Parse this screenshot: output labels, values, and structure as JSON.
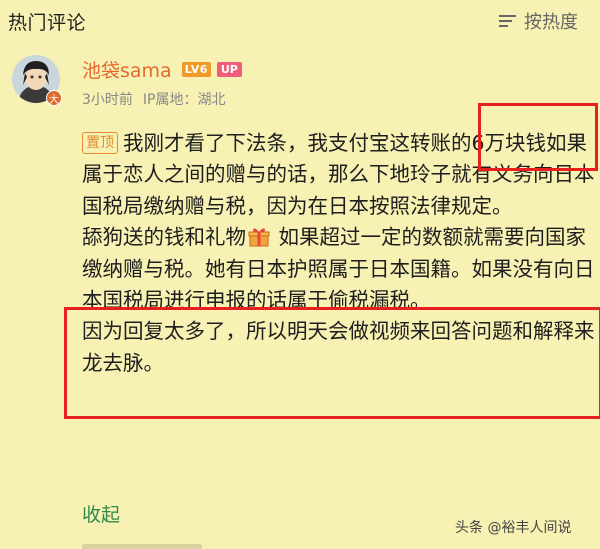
{
  "header": {
    "title": "热门评论",
    "sort_label": "按热度",
    "sort_icon": "sort-lines-icon"
  },
  "comment": {
    "user": {
      "name": "池袋sama",
      "level": "LV6",
      "badge": "UP",
      "avatar_badge": "大"
    },
    "meta": {
      "time": "3小时前",
      "location": "IP属地：湖北"
    },
    "pin_tag": "置顶",
    "paragraphs": {
      "p1": "我刚才看了下法条，我支付宝这转账的6万块钱如果属于恋人之间的赠与的话，那么下地玲子就有义务向日本国税局缴纳赠与税，因为在日本按照法律规定。",
      "p2a": "舔狗送的钱和礼物",
      "p2b": " 如果超过一定的数额就需要向国家缴纳赠与税。她有日本护照属于日本国籍。如果没有向日本国税局进行申报的话属于偷税漏税。",
      "p3": "因为回复太多了，所以明天会做视频来回答问题和解释来龙去脉。"
    },
    "gift_icon": "gift-icon",
    "collapse_label": "收起"
  },
  "watermark": "头条 @裕丰人间说",
  "colors": {
    "background": "#f7f1b4",
    "username": "#e26b2f",
    "highlight_box": "#e61f1f",
    "collapse_link": "#2f8a4a"
  }
}
